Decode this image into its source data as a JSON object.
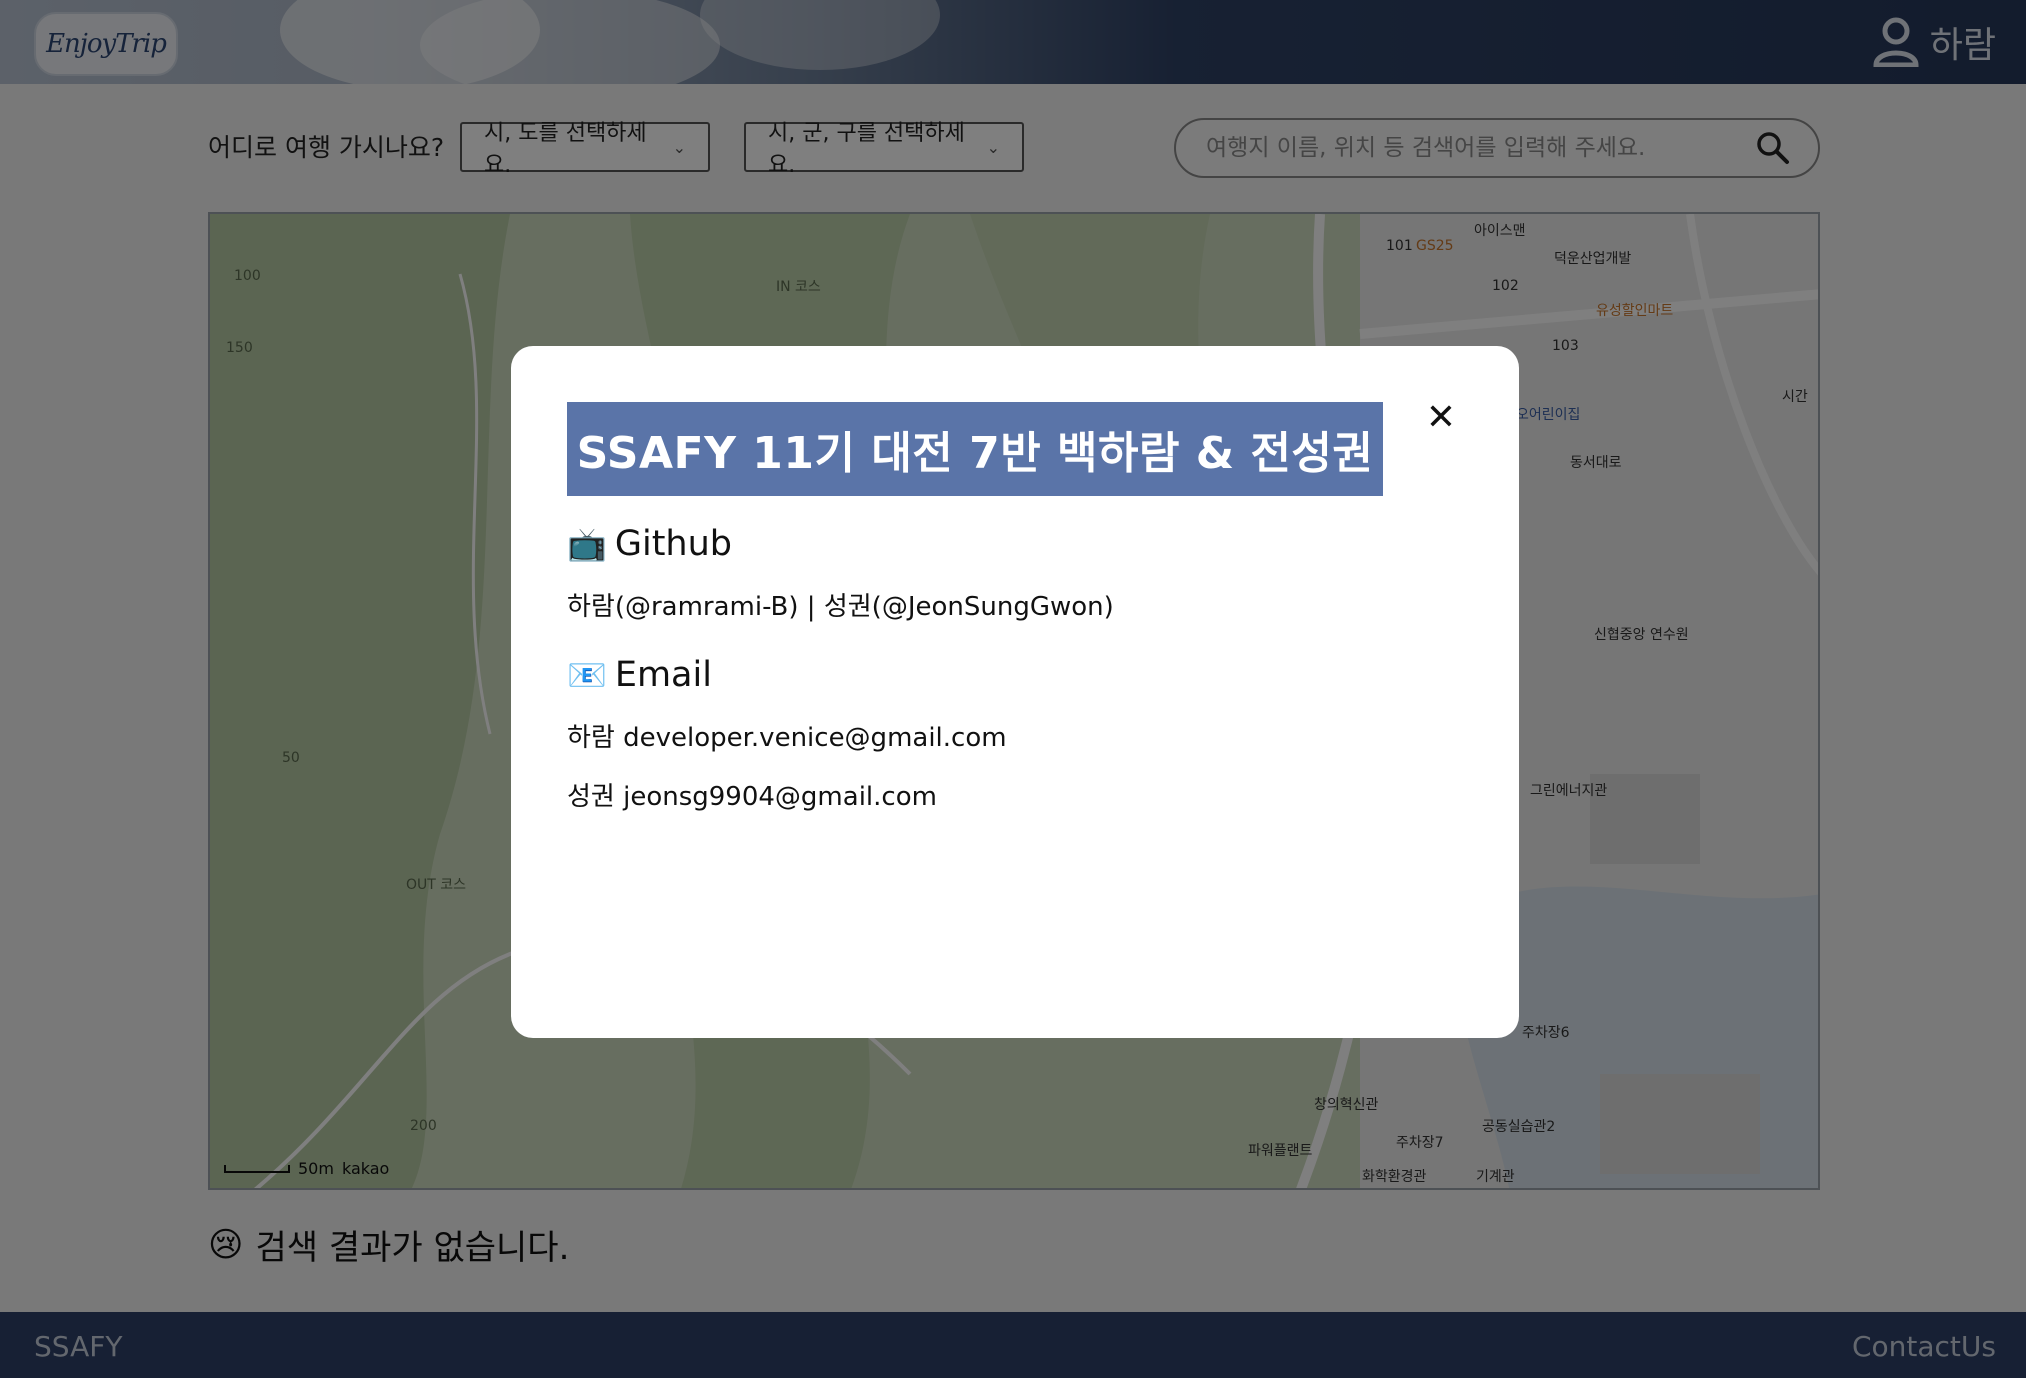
{
  "header": {
    "logo_text": "EnjoyTrip",
    "user_icon": "user-icon",
    "user_name": "하람"
  },
  "search": {
    "question_label": "어디로 여행 가시나요?",
    "sido_select": "시, 도를 선택하세요.",
    "gugun_select": "시, 군, 구를 선택하세요.",
    "keyword_placeholder": "여행지 이름, 위치 등 검색어를 입력해 주세요.",
    "search_icon": "search-icon"
  },
  "map": {
    "labels": [
      "IN 코스",
      "OUT 코스",
      "아이스맨",
      "GS25",
      "덕운산업개발",
      "유성할인마트",
      "오어린이집",
      "신협중앙 연수원",
      "그린에너지관",
      "창의혁신관",
      "파워플랜트",
      "주차장7",
      "화학환경관",
      "기계관",
      "공동실습관2",
      "주차장6",
      "시간",
      "동서대로",
      "101",
      "102",
      "103"
    ],
    "contour_labels": [
      "50",
      "100",
      "150",
      "200"
    ],
    "scale_text": "50m",
    "provider": "kakao"
  },
  "results": {
    "empty_emoji": "😢",
    "empty_text": "검색 결과가 없습니다."
  },
  "footer": {
    "left": "SSAFY",
    "right": "ContactUs"
  },
  "modal": {
    "title": "SSAFY 11기 대전 7반 백하람 & 전성권",
    "close_icon": "close-icon",
    "github_emoji": "📺",
    "github_heading": "Github",
    "github_text": "하람(@ramrami-B) | 성권(@JeonSungGwon)",
    "email_emoji": "📧",
    "email_heading": "Email",
    "email_1": "하람 developer.venice@gmail.com",
    "email_2": "성권 jeonsg9904@gmail.com"
  }
}
